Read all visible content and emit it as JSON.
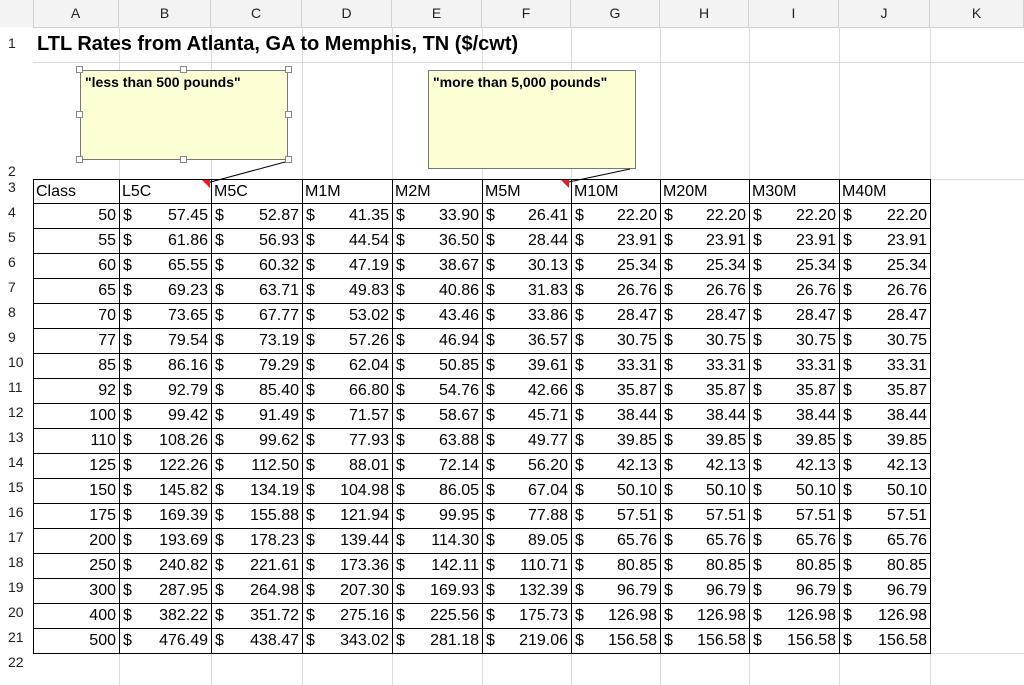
{
  "columns": [
    "A",
    "B",
    "C",
    "D",
    "E",
    "F",
    "G",
    "H",
    "I",
    "J",
    "K"
  ],
  "rows": [
    "1",
    "2",
    "3",
    "4",
    "5",
    "6",
    "7",
    "8",
    "9",
    "10",
    "11",
    "12",
    "13",
    "14",
    "15",
    "16",
    "17",
    "18",
    "19",
    "20",
    "21",
    "22"
  ],
  "title": "LTL Rates from Atlanta, GA to Memphis, TN ($/cwt)",
  "comments": {
    "left": "\"less than 500 pounds\"",
    "right": "\"more than 5,000 pounds\""
  },
  "currency_symbol": "$",
  "table": {
    "headers": [
      "Class",
      "L5C",
      "M5C",
      "M1M",
      "M2M",
      "M5M",
      "M10M",
      "M20M",
      "M30M",
      "M40M"
    ],
    "rows": [
      {
        "cls": "50",
        "v": [
          "57.45",
          "52.87",
          "41.35",
          "33.90",
          "26.41",
          "22.20",
          "22.20",
          "22.20",
          "22.20"
        ]
      },
      {
        "cls": "55",
        "v": [
          "61.86",
          "56.93",
          "44.54",
          "36.50",
          "28.44",
          "23.91",
          "23.91",
          "23.91",
          "23.91"
        ]
      },
      {
        "cls": "60",
        "v": [
          "65.55",
          "60.32",
          "47.19",
          "38.67",
          "30.13",
          "25.34",
          "25.34",
          "25.34",
          "25.34"
        ]
      },
      {
        "cls": "65",
        "v": [
          "69.23",
          "63.71",
          "49.83",
          "40.86",
          "31.83",
          "26.76",
          "26.76",
          "26.76",
          "26.76"
        ]
      },
      {
        "cls": "70",
        "v": [
          "73.65",
          "67.77",
          "53.02",
          "43.46",
          "33.86",
          "28.47",
          "28.47",
          "28.47",
          "28.47"
        ]
      },
      {
        "cls": "77",
        "v": [
          "79.54",
          "73.19",
          "57.26",
          "46.94",
          "36.57",
          "30.75",
          "30.75",
          "30.75",
          "30.75"
        ]
      },
      {
        "cls": "85",
        "v": [
          "86.16",
          "79.29",
          "62.04",
          "50.85",
          "39.61",
          "33.31",
          "33.31",
          "33.31",
          "33.31"
        ]
      },
      {
        "cls": "92",
        "v": [
          "92.79",
          "85.40",
          "66.80",
          "54.76",
          "42.66",
          "35.87",
          "35.87",
          "35.87",
          "35.87"
        ]
      },
      {
        "cls": "100",
        "v": [
          "99.42",
          "91.49",
          "71.57",
          "58.67",
          "45.71",
          "38.44",
          "38.44",
          "38.44",
          "38.44"
        ]
      },
      {
        "cls": "110",
        "v": [
          "108.26",
          "99.62",
          "77.93",
          "63.88",
          "49.77",
          "39.85",
          "39.85",
          "39.85",
          "39.85"
        ]
      },
      {
        "cls": "125",
        "v": [
          "122.26",
          "112.50",
          "88.01",
          "72.14",
          "56.20",
          "42.13",
          "42.13",
          "42.13",
          "42.13"
        ]
      },
      {
        "cls": "150",
        "v": [
          "145.82",
          "134.19",
          "104.98",
          "86.05",
          "67.04",
          "50.10",
          "50.10",
          "50.10",
          "50.10"
        ]
      },
      {
        "cls": "175",
        "v": [
          "169.39",
          "155.88",
          "121.94",
          "99.95",
          "77.88",
          "57.51",
          "57.51",
          "57.51",
          "57.51"
        ]
      },
      {
        "cls": "200",
        "v": [
          "193.69",
          "178.23",
          "139.44",
          "114.30",
          "89.05",
          "65.76",
          "65.76",
          "65.76",
          "65.76"
        ]
      },
      {
        "cls": "250",
        "v": [
          "240.82",
          "221.61",
          "173.36",
          "142.11",
          "110.71",
          "80.85",
          "80.85",
          "80.85",
          "80.85"
        ]
      },
      {
        "cls": "300",
        "v": [
          "287.95",
          "264.98",
          "207.30",
          "169.93",
          "132.39",
          "96.79",
          "96.79",
          "96.79",
          "96.79"
        ]
      },
      {
        "cls": "400",
        "v": [
          "382.22",
          "351.72",
          "275.16",
          "225.56",
          "175.73",
          "126.98",
          "126.98",
          "126.98",
          "126.98"
        ]
      },
      {
        "cls": "500",
        "v": [
          "476.49",
          "438.47",
          "343.02",
          "281.18",
          "219.06",
          "156.58",
          "156.58",
          "156.58",
          "156.58"
        ]
      }
    ]
  }
}
